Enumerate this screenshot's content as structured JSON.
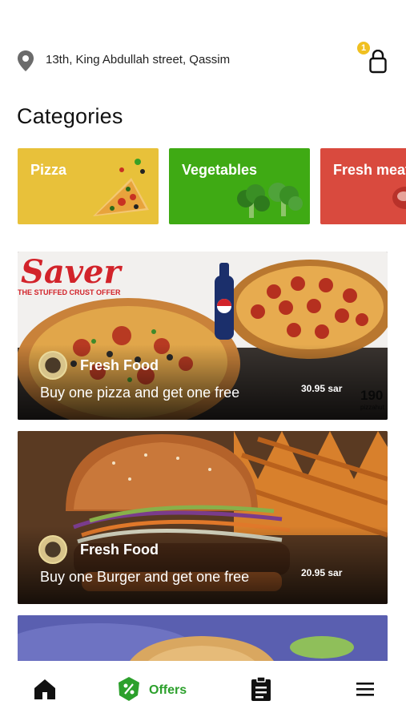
{
  "header": {
    "address": "13th, King Abdullah street, Qassim",
    "cart_count": "1",
    "location_icon": "map-pin-icon",
    "cart_icon": "shopping-bag-icon"
  },
  "categories": {
    "title": "Categories",
    "items": [
      {
        "label": "Pizza",
        "color": "#e8c13a"
      },
      {
        "label": "Vegetables",
        "color": "#3faa14"
      },
      {
        "label": "Fresh meat",
        "color": "#d94a3e"
      }
    ]
  },
  "offers": [
    {
      "vendor": "Fresh Food",
      "text": "Buy one pizza and get one free",
      "price": "30.95 sar",
      "banner_text": "Saver",
      "banner_sub": "THE STUFFED CRUST OFFER",
      "corner_text": "190",
      "corner_sub": "pizzahut"
    },
    {
      "vendor": "Fresh Food",
      "text": "Buy one Burger and get one free",
      "price": "20.95 sar"
    }
  ],
  "nav": {
    "items": [
      {
        "icon": "home-icon"
      },
      {
        "icon": "offers-tag-icon",
        "label": "Offers"
      },
      {
        "icon": "orders-clipboard-icon"
      },
      {
        "icon": "menu-icon"
      }
    ],
    "accent": "#2ca02c"
  }
}
